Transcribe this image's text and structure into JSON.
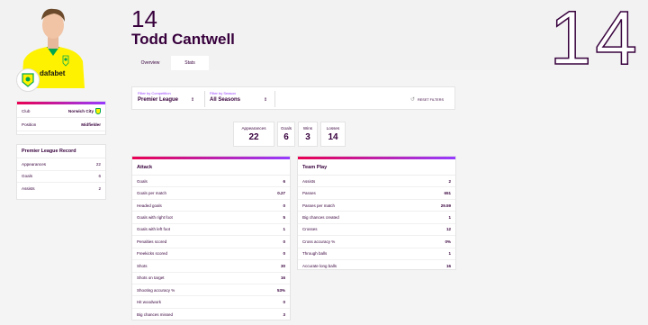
{
  "header": {
    "shirt_number": "14",
    "name": "Todd Cantwell",
    "big_number": "14"
  },
  "tabs": [
    {
      "label": "Overview",
      "active": false
    },
    {
      "label": "Stats",
      "active": true
    }
  ],
  "player_info": {
    "club_label": "Club",
    "club_value": "Norwich City",
    "position_label": "Position",
    "position_value": "Midfielder"
  },
  "record": {
    "title": "Premier League Record",
    "rows": [
      {
        "label": "Appearances",
        "value": "22"
      },
      {
        "label": "Goals",
        "value": "6"
      },
      {
        "label": "Assists",
        "value": "2"
      }
    ]
  },
  "filters": {
    "competition_label": "Filter by Competition",
    "competition_value": "Premier League",
    "season_label": "Filter by Season",
    "season_value": "All Seasons",
    "reset_label": "RESET FILTERS"
  },
  "summary": [
    {
      "label": "Appearances",
      "value": "22"
    },
    {
      "label": "Goals",
      "value": "6"
    },
    {
      "label": "Wins",
      "value": "3"
    },
    {
      "label": "Losses",
      "value": "14"
    }
  ],
  "attack": {
    "title": "Attack",
    "rows": [
      {
        "label": "Goals",
        "value": "6"
      },
      {
        "label": "Goals per match",
        "value": "0.27"
      },
      {
        "label": "Headed goals",
        "value": "0"
      },
      {
        "label": "Goals with right foot",
        "value": "5"
      },
      {
        "label": "Goals with left foot",
        "value": "1"
      },
      {
        "label": "Penalties scored",
        "value": "0"
      },
      {
        "label": "Freekicks scored",
        "value": "0"
      },
      {
        "label": "Shots",
        "value": "30"
      },
      {
        "label": "Shots on target",
        "value": "16"
      },
      {
        "label": "Shooting accuracy %",
        "value": "53%"
      },
      {
        "label": "Hit woodwork",
        "value": "0"
      },
      {
        "label": "Big chances missed",
        "value": "3"
      }
    ]
  },
  "team_play": {
    "title": "Team Play",
    "rows": [
      {
        "label": "Assists",
        "value": "2"
      },
      {
        "label": "Passes",
        "value": "651"
      },
      {
        "label": "Passes per match",
        "value": "29.59"
      },
      {
        "label": "Big chances created",
        "value": "1"
      },
      {
        "label": "Crosses",
        "value": "12"
      },
      {
        "label": "Cross accuracy %",
        "value": "0%"
      },
      {
        "label": "Through balls",
        "value": "1"
      },
      {
        "label": "Accurate long balls",
        "value": "16"
      }
    ]
  },
  "colors": {
    "primary": "#37003c",
    "accent_pink": "#e90052",
    "accent_purple": "#963cff",
    "club_yellow": "#fff200",
    "club_green": "#00a650"
  }
}
